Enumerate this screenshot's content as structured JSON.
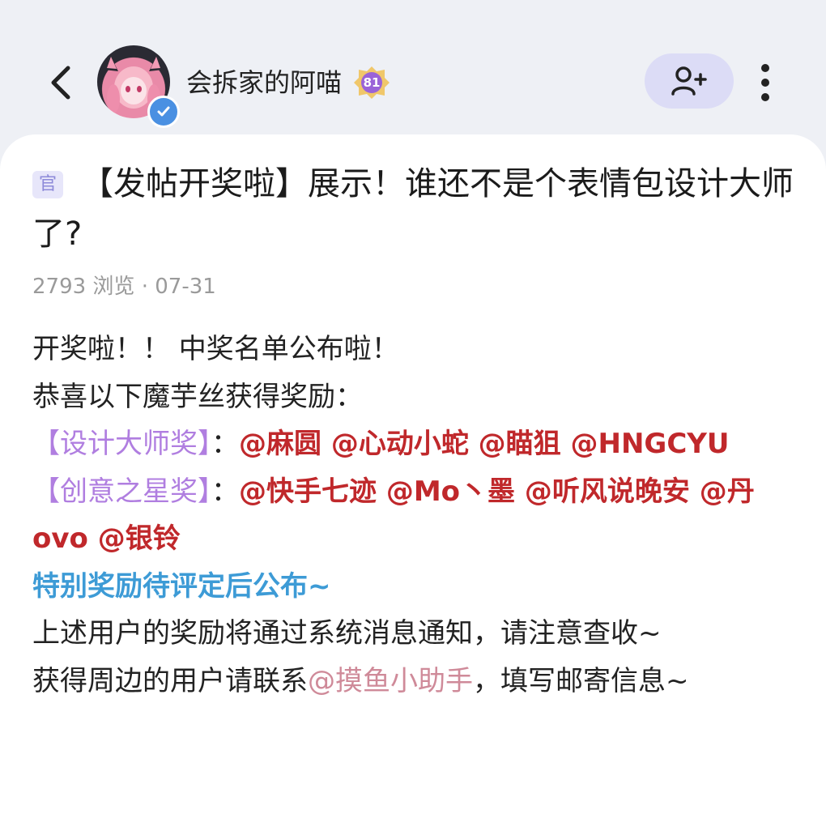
{
  "header": {
    "back_icon": "chevron-left-icon",
    "username": "会拆家的阿喵",
    "level": "81",
    "follow_icon": "user-plus-icon",
    "more_icon": "more-vertical-icon"
  },
  "post": {
    "tag": "官",
    "title": "【发帖开奖啦】展示！谁还不是个表情包设计大师了?",
    "views": "2793 浏览",
    "separator": "·",
    "date": "07-31"
  },
  "content": {
    "line1": "开奖啦！！ 中奖名单公布啦！",
    "line2": "恭喜以下魔芋丝获得奖励：",
    "award1_name": "【设计大师奖】",
    "award1_sep": "：",
    "award1_winners": "@麻圆 @心动小蛇 @瞄狙 @HNGCYU",
    "award2_name": "【创意之星奖】",
    "award2_sep": "：",
    "award2_winners": "@快手七迹 @Mo丶墨 @听风说晚安 @丹ovo @银铃",
    "special_note": "特别奖励待评定后公布~",
    "notice1": "上述用户的奖励将通过系统消息通知，请注意查收~",
    "notice2_prefix": "获得周边的用户请联系",
    "notice2_mention": "@摸鱼小助手",
    "notice2_suffix": "，填写邮寄信息~"
  },
  "colors": {
    "background": "#eef0f5",
    "award": "#b07ee0",
    "winner": "#c0282b",
    "special": "#3d9bd6",
    "mention": "#cf8a99",
    "follow_button": "#dcdcf6"
  }
}
